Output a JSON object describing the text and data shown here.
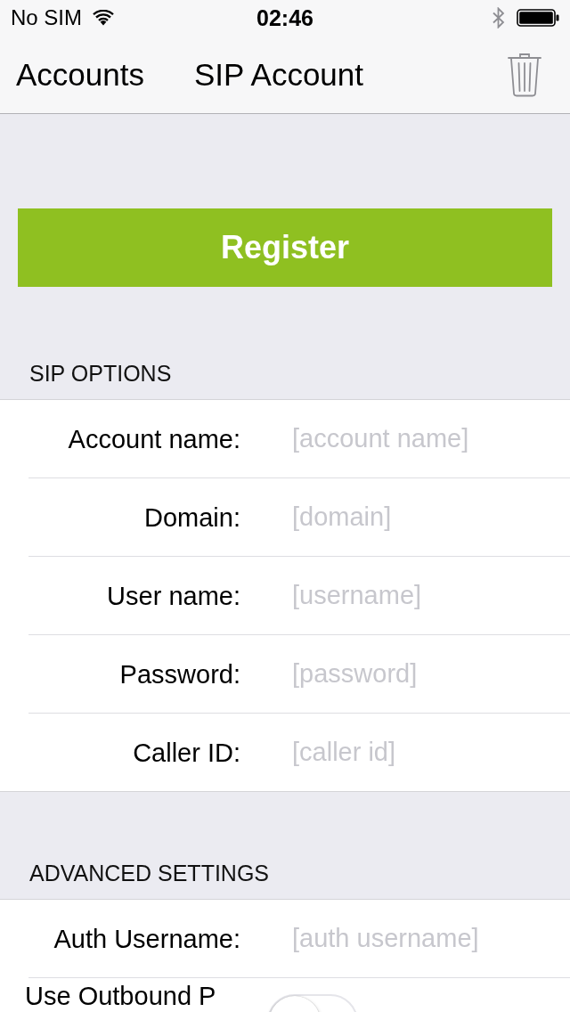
{
  "status_bar": {
    "carrier": "No SIM",
    "time": "02:46"
  },
  "nav_bar": {
    "back": "Accounts",
    "title": "SIP Account"
  },
  "register_button": {
    "label": "Register"
  },
  "sections": [
    {
      "header": "SIP OPTIONS",
      "rows": [
        {
          "kind": "field",
          "label": "Account name:",
          "placeholder": "[account name]"
        },
        {
          "kind": "field",
          "label": "Domain:",
          "placeholder": "[domain]"
        },
        {
          "kind": "field",
          "label": "User name:",
          "placeholder": "[username]"
        },
        {
          "kind": "field",
          "label": "Password:",
          "placeholder": "[password]"
        },
        {
          "kind": "field",
          "label": "Caller ID:",
          "placeholder": "[caller id]"
        }
      ]
    },
    {
      "header": "ADVANCED SETTINGS",
      "rows": [
        {
          "kind": "field",
          "label": "Auth Username:",
          "placeholder": "[auth username]"
        },
        {
          "kind": "toggle",
          "label": "Use Outbound P",
          "on": false
        }
      ]
    }
  ]
}
